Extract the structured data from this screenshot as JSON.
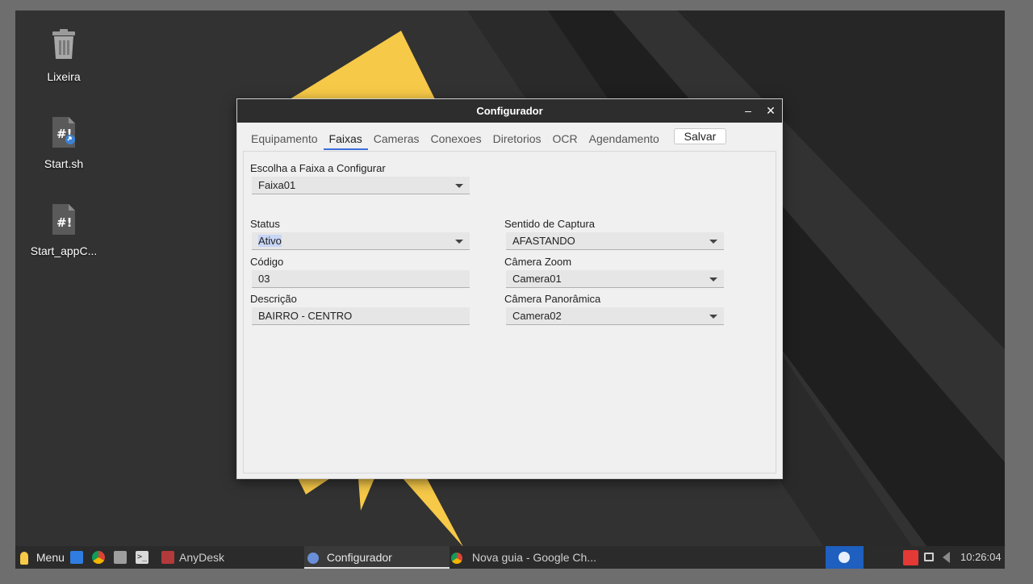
{
  "desktop": {
    "icons": [
      {
        "label": "Lixeira",
        "icon": "trash-icon"
      },
      {
        "label": "Start.sh",
        "icon": "script-icon"
      },
      {
        "label": "Start_appC...",
        "icon": "script-icon"
      }
    ]
  },
  "window": {
    "title": "Configurador",
    "minimize": "–",
    "close": "✕",
    "tabs": [
      "Equipamento",
      "Faixas",
      "Cameras",
      "Conexoes",
      "Diretorios",
      "OCR",
      "Agendamento"
    ],
    "active_tab": "Faixas",
    "save_label": "Salvar",
    "form": {
      "faixa_label": "Escolha a Faixa a Configurar",
      "faixa_value": "Faixa01",
      "status_label": "Status",
      "status_value": "Ativo",
      "codigo_label": "Código",
      "codigo_value": "03",
      "descricao_label": "Descrição",
      "descricao_value": "BAIRRO - CENTRO",
      "sentido_label": "Sentido de Captura",
      "sentido_value": "AFASTANDO",
      "zoom_label": "Câmera Zoom",
      "zoom_value": "Camera01",
      "panoramica_label": "Câmera Panorâmica",
      "panoramica_value": "Camera02"
    }
  },
  "taskbar": {
    "menu_label": "Menu",
    "apps": [
      {
        "label": "AnyDesk",
        "icon": "anydesk-icon"
      },
      {
        "label": "Configurador",
        "icon": "configurador-icon"
      },
      {
        "label": "Nova guia - Google Ch...",
        "icon": "chrome-icon"
      }
    ],
    "clock": "10:26:04"
  },
  "colors": {
    "accent": "#3d6fd8",
    "titlebar": "#2d2d2d",
    "wallpaper_yellow": "#f7c948",
    "anydesk_red": "#e53935"
  }
}
